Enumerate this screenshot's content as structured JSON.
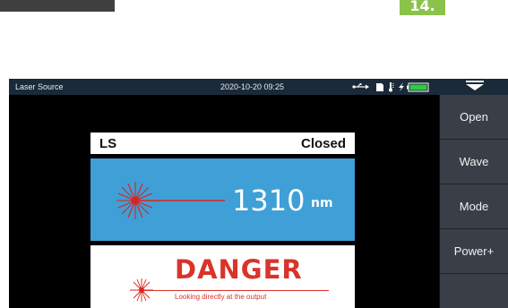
{
  "step_badge": "14.",
  "status_bar": {
    "title": "Laser Source",
    "datetime": "2020-10-20 09:25",
    "icons": [
      "usb-icon",
      "sd-card-icon",
      "thermometer-icon",
      "charging-icon",
      "battery-icon"
    ]
  },
  "panel": {
    "mode_label": "LS",
    "state_label": "Closed",
    "wavelength_value": "1310",
    "wavelength_unit": "nm",
    "danger_title": "DANGER",
    "danger_text": "Looking directly at the output"
  },
  "side_menu": {
    "items": [
      {
        "label": "Open"
      },
      {
        "label": "Wave"
      },
      {
        "label": "Mode"
      },
      {
        "label": "Power+"
      }
    ]
  },
  "colors": {
    "wave_panel": "#3ea0d6",
    "danger_red": "#d9342b",
    "status_bar": "#1b2a38",
    "badge_green": "#8bc34a"
  }
}
